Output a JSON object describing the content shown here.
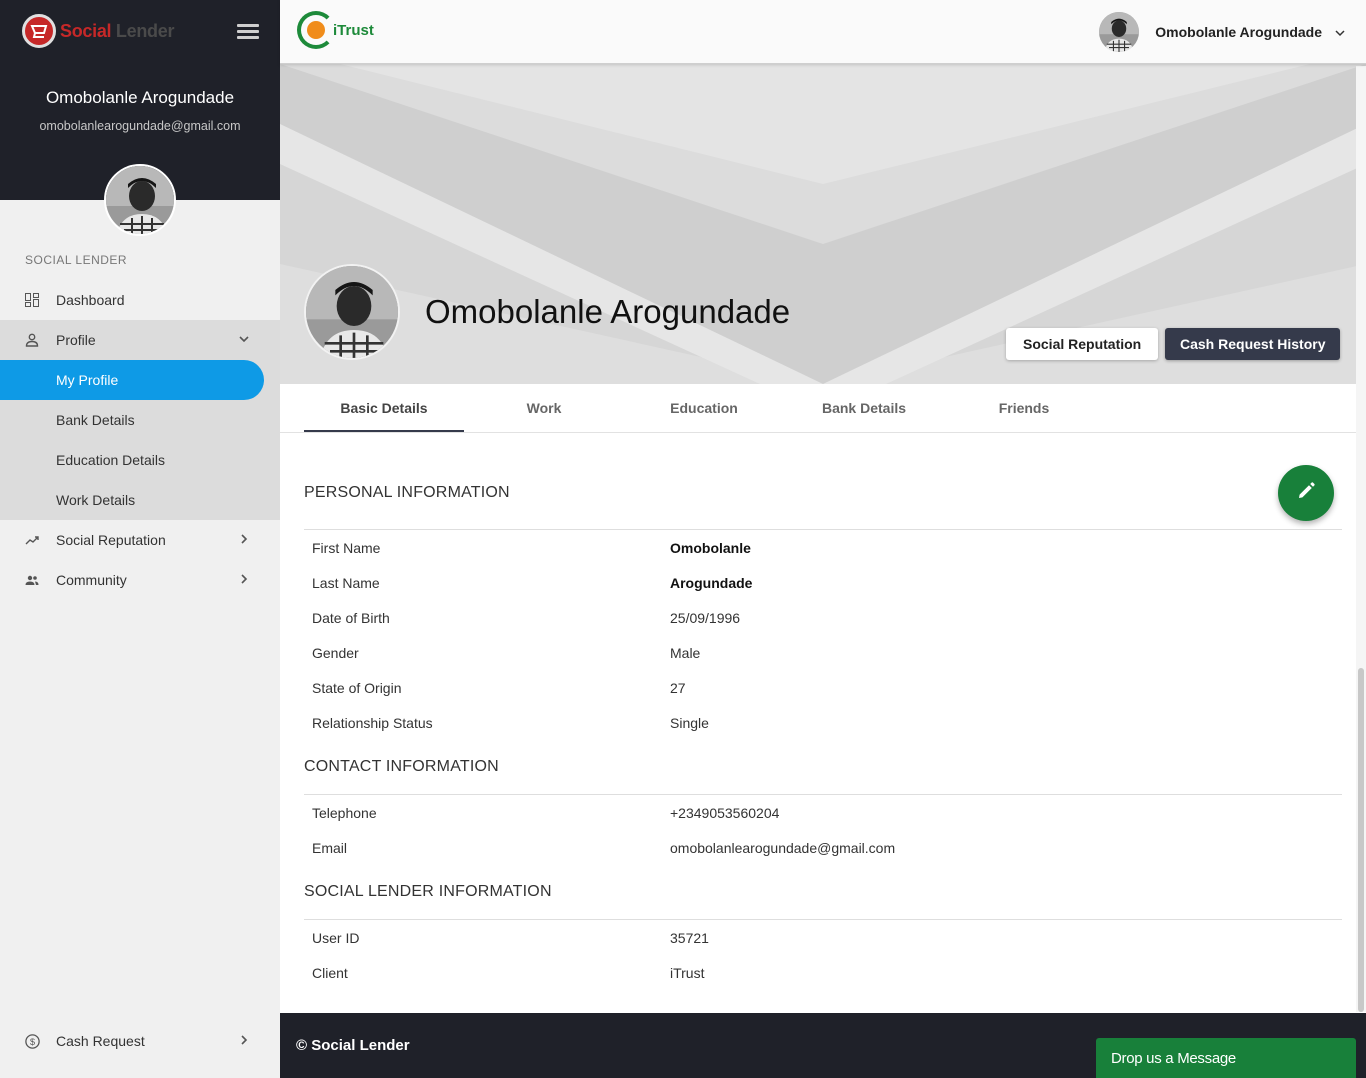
{
  "sidebar": {
    "brand": {
      "part1": "Social",
      "part2": " Lender"
    },
    "user_name": "Omobolanle Arogundade",
    "user_email": "omobolanlearogundade@gmail.com",
    "section_label": "SOCIAL LENDER",
    "items": {
      "dashboard": "Dashboard",
      "profile": "Profile",
      "my_profile": "My Profile",
      "bank_details": "Bank Details",
      "education_details": "Education Details",
      "work_details": "Work Details",
      "social_reputation": "Social Reputation",
      "community": "Community",
      "cash_request": "Cash Request"
    }
  },
  "topbar": {
    "logo_text": "iTrust",
    "user_name": "Omobolanle Arogundade"
  },
  "hero": {
    "name": "Omobolanle Arogundade",
    "social_reputation_button": "Social Reputation",
    "cash_history_button": "Cash Request History"
  },
  "tabs": [
    "Basic Details",
    "Work",
    "Education",
    "Bank Details",
    "Friends"
  ],
  "personal": {
    "title": "PERSONAL INFORMATION",
    "rows": [
      {
        "label": "First Name",
        "value": "Omobolanle"
      },
      {
        "label": "Last Name",
        "value": "Arogundade"
      },
      {
        "label": "Date of Birth",
        "value": "25/09/1996"
      },
      {
        "label": "Gender",
        "value": "Male"
      },
      {
        "label": "State of Origin",
        "value": "27"
      },
      {
        "label": "Relationship Status",
        "value": "Single"
      }
    ]
  },
  "contact": {
    "title": "CONTACT INFORMATION",
    "rows": [
      {
        "label": "Telephone",
        "value": "+2349053560204"
      },
      {
        "label": "Email",
        "value": "omobolanlearogundade@gmail.com"
      }
    ]
  },
  "social_lender": {
    "title": "SOCIAL LENDER INFORMATION",
    "rows": [
      {
        "label": "User ID",
        "value": "35721"
      },
      {
        "label": "Client",
        "value": "iTrust"
      }
    ]
  },
  "footer": {
    "copyright": "© Social Lender",
    "drop_message": "Drop us a Message"
  },
  "colors": {
    "sidebar_dark": "#1f2129",
    "active_blue": "#0e9ae6",
    "accent_green": "#18803a",
    "button_dark": "#353a4b"
  }
}
